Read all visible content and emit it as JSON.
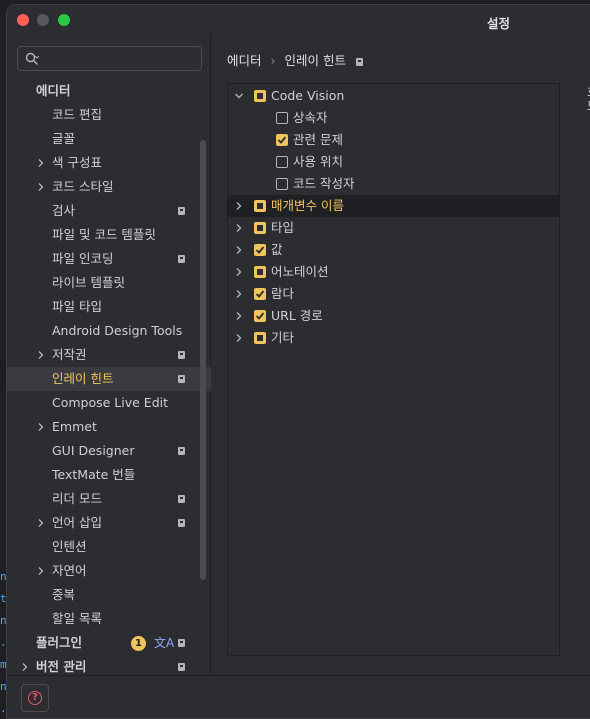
{
  "window": {
    "title": "설정"
  },
  "background_code": [
    "n",
    "t",
    "n",
    ".",
    "m",
    "n",
    "."
  ],
  "search": {
    "placeholder": "",
    "value": ""
  },
  "sidebar": {
    "section_editor": "에디터",
    "items": [
      {
        "label": "코드 편집",
        "indent": 2,
        "chevron": false,
        "lock": false
      },
      {
        "label": "글꼴",
        "indent": 2,
        "chevron": false,
        "lock": false
      },
      {
        "label": "색 구성표",
        "indent": 2,
        "chevron": true,
        "lock": false
      },
      {
        "label": "코드 스타일",
        "indent": 2,
        "chevron": true,
        "lock": false
      },
      {
        "label": "검사",
        "indent": 2,
        "chevron": false,
        "lock": true
      },
      {
        "label": "파일 및 코드 템플릿",
        "indent": 2,
        "chevron": false,
        "lock": false
      },
      {
        "label": "파일 인코딩",
        "indent": 2,
        "chevron": false,
        "lock": true
      },
      {
        "label": "라이브 템플릿",
        "indent": 2,
        "chevron": false,
        "lock": false
      },
      {
        "label": "파일 타입",
        "indent": 2,
        "chevron": false,
        "lock": false
      },
      {
        "label": "Android Design Tools",
        "indent": 2,
        "chevron": false,
        "lock": false
      },
      {
        "label": "저작권",
        "indent": 2,
        "chevron": true,
        "lock": true
      },
      {
        "label": "인레이 힌트",
        "indent": 2,
        "chevron": false,
        "lock": true,
        "selected": true
      },
      {
        "label": "Compose Live Edit",
        "indent": 2,
        "chevron": false,
        "lock": false
      },
      {
        "label": "Emmet",
        "indent": 2,
        "chevron": true,
        "lock": false
      },
      {
        "label": "GUI Designer",
        "indent": 2,
        "chevron": false,
        "lock": true
      },
      {
        "label": "TextMate 번들",
        "indent": 2,
        "chevron": false,
        "lock": false
      },
      {
        "label": "리더 모드",
        "indent": 2,
        "chevron": false,
        "lock": true
      },
      {
        "label": "언어 삽입",
        "indent": 2,
        "chevron": true,
        "lock": true
      },
      {
        "label": "인텐션",
        "indent": 2,
        "chevron": false,
        "lock": false
      },
      {
        "label": "자연어",
        "indent": 2,
        "chevron": true,
        "lock": false
      },
      {
        "label": "중복",
        "indent": 2,
        "chevron": false,
        "lock": false
      },
      {
        "label": "할일 목록",
        "indent": 2,
        "chevron": false,
        "lock": false
      }
    ],
    "plugins": {
      "label": "플러그인",
      "badge": "1",
      "translate_icon": "文A"
    },
    "vcs": {
      "label": "버전 관리"
    }
  },
  "breadcrumb": {
    "parent": "에디터",
    "separator": "›",
    "current": "인레이 힌트"
  },
  "hints_tree": [
    {
      "label": "Code Vision",
      "level": 0,
      "expanded": true,
      "state": "partial"
    },
    {
      "label": "상속자",
      "level": 1,
      "state": "empty"
    },
    {
      "label": "관련 문제",
      "level": 1,
      "state": "checked"
    },
    {
      "label": "사용 위치",
      "level": 1,
      "state": "empty"
    },
    {
      "label": "코드 작성자",
      "level": 1,
      "state": "empty"
    },
    {
      "label": "매개변수 이름",
      "level": 0,
      "expanded": false,
      "state": "partial",
      "highlighted": true
    },
    {
      "label": "타입",
      "level": 0,
      "expanded": false,
      "state": "partial"
    },
    {
      "label": "값",
      "level": 0,
      "expanded": false,
      "state": "checked"
    },
    {
      "label": "어노테이션",
      "level": 0,
      "expanded": false,
      "state": "partial"
    },
    {
      "label": "람다",
      "level": 0,
      "expanded": false,
      "state": "checked"
    },
    {
      "label": "URL 경로",
      "level": 0,
      "expanded": false,
      "state": "checked"
    },
    {
      "label": "기타",
      "level": 0,
      "expanded": false,
      "state": "partial"
    }
  ],
  "side_peek": [
    "호",
    "모"
  ],
  "colors": {
    "accent": "#f2c55c",
    "background": "#2b2d30",
    "selection": "#393b40",
    "help": "#e55765"
  },
  "bottom": {
    "help_icon": "question-circle-icon"
  }
}
